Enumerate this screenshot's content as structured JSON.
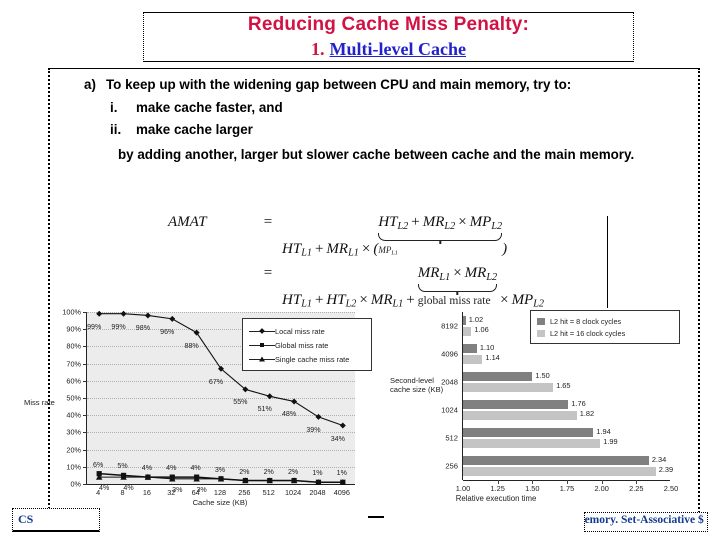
{
  "title": {
    "line1": "Reducing Cache Miss Penalty:",
    "number": "1.",
    "link": "Multi-level Cache"
  },
  "bullets": {
    "a_marker": "a)",
    "a_text": "To keep up with the widening gap between CPU and main memory, try to:",
    "i_marker": "i.",
    "i_text": "make cache faster, and",
    "ii_marker": "ii.",
    "ii_text": "make cache larger",
    "closing": "by adding another, larger but slower cache between cache and the main memory."
  },
  "equations": {
    "lhs": "AMAT",
    "eq1_sign": "=",
    "eq2_sign": "=",
    "brace1_label": "MPL1",
    "brace2_label": "global miss rate"
  },
  "line_chart": {
    "legend_position": "top-right",
    "legend": [
      "Local miss rate",
      "Global miss rate",
      "Single cache miss rate"
    ]
  },
  "bar_chart": {
    "legend_position": "top-right",
    "legend": [
      "L2 hit = 8 clock cycles",
      "L2 hit = 16 clock cycles"
    ]
  },
  "footer": {
    "left": "CS",
    "right": "memory. Set-Associative $"
  },
  "chart_data": [
    {
      "type": "line",
      "title": "",
      "xlabel": "Cache size (KB)",
      "ylabel": "Miss rate",
      "categories": [
        4,
        8,
        16,
        32,
        64,
        128,
        256,
        512,
        1024,
        2048,
        4096
      ],
      "xticklabels": [
        "4",
        "8",
        "16",
        "32",
        "64",
        "128",
        "256",
        "512",
        "1024",
        "2048",
        "4096"
      ],
      "yticklabels": [
        "0%",
        "10%",
        "20%",
        "30%",
        "40%",
        "50%",
        "60%",
        "70%",
        "80%",
        "90%",
        "100%"
      ],
      "ylim": [
        0,
        100
      ],
      "grid": true,
      "series": [
        {
          "name": "Local miss rate",
          "values": [
            99,
            99,
            98,
            96,
            88,
            67,
            55,
            51,
            48,
            39,
            34
          ],
          "labels": [
            "99%",
            "99%",
            "98%",
            "96%",
            "88%",
            "67%",
            "55%",
            "51%",
            "48%",
            "39%",
            "34%"
          ],
          "marker": "diamond"
        },
        {
          "name": "Global miss rate",
          "values": [
            6,
            5,
            4,
            4,
            4,
            3,
            2,
            2,
            2,
            1,
            1
          ],
          "labels": [
            "6%",
            "5%",
            "4%",
            "4%",
            "4%",
            "3%",
            "2%",
            "2%",
            "2%",
            "1%",
            "1%"
          ],
          "marker": "square"
        },
        {
          "name": "Single cache miss rate",
          "values": [
            4,
            4,
            4,
            3,
            3,
            3,
            2,
            2,
            2,
            1,
            1
          ],
          "labels": [
            "4%",
            "4%",
            "",
            "3%",
            "3%",
            "",
            "",
            "",
            "",
            "",
            ""
          ],
          "marker": "triangle"
        }
      ]
    },
    {
      "type": "bar",
      "orientation": "horizontal",
      "title": "",
      "xlabel": "Relative execution time",
      "ylabel": "Second-level cache size (KB)",
      "categories": [
        "8192",
        "4096",
        "2048",
        "1024",
        "512",
        "256"
      ],
      "xticklabels": [
        "1.00",
        "1.25",
        "1.50",
        "1.75",
        "2.00",
        "2.25",
        "2.50"
      ],
      "xlim": [
        1.0,
        2.5
      ],
      "grid": false,
      "series": [
        {
          "name": "L2 hit = 8 clock cycles",
          "values": [
            1.02,
            1.1,
            1.5,
            1.76,
            1.94,
            2.34
          ],
          "labels": [
            "1.02",
            "1.10",
            "1.50",
            "1.76",
            "1.94",
            "2.34"
          ],
          "color": "#808080"
        },
        {
          "name": "L2 hit = 16 clock cycles",
          "values": [
            1.06,
            1.14,
            1.65,
            1.82,
            1.99,
            2.39
          ],
          "labels": [
            "1.06",
            "1.14",
            "1.65",
            "1.82",
            "1.99",
            "2.39"
          ],
          "color": "#c4c4c4"
        }
      ]
    }
  ]
}
